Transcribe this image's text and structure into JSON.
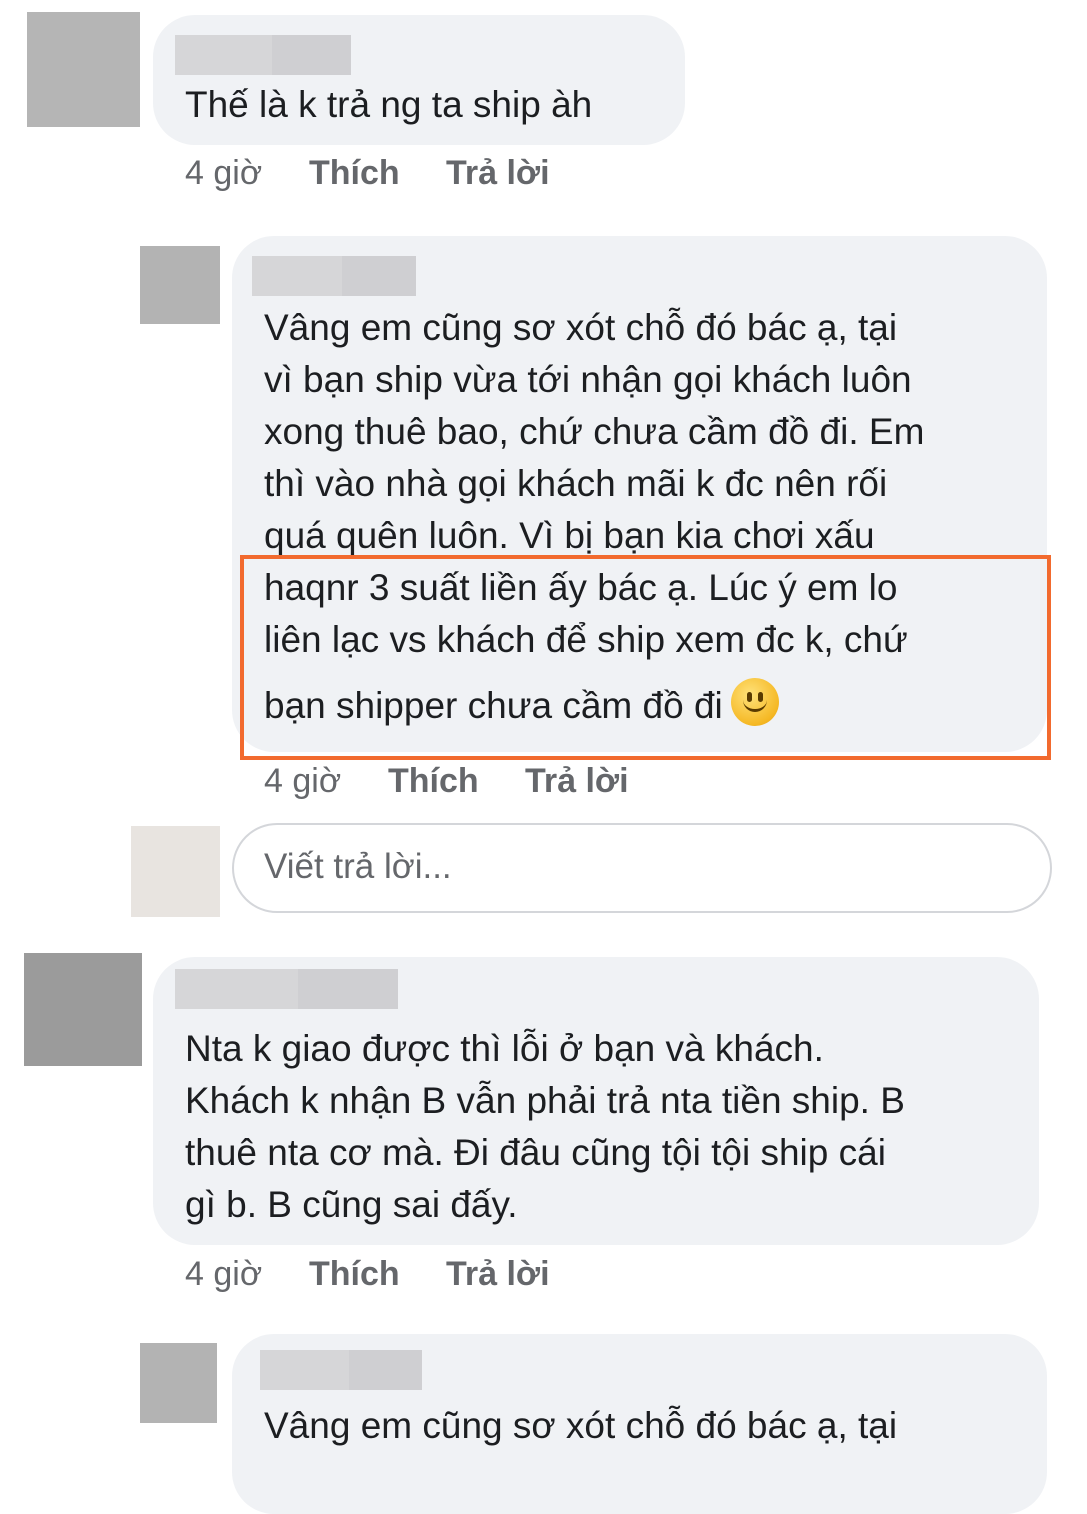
{
  "comments": [
    {
      "text_lines": [
        "Thế là k trả ng ta ship àh"
      ],
      "time": "4 giờ",
      "like": "Thích",
      "reply": "Trả lời"
    },
    {
      "text_lines": [
        "Vâng em cũng sơ xót chỗ đó bác ạ, tại",
        "vì bạn ship vừa tới nhận gọi khách luôn",
        "xong thuê bao, chứ chưa cầm đồ đi. Em",
        "thì vào nhà gọi khách mãi k đc nên rối",
        "quá quên luôn. Vì bị bạn kia chơi xấu",
        "haqnr 3 suất liền ấy bác ạ. Lúc ý em lo",
        "liên lạc vs khách để ship xem đc k, chứ",
        "bạn shipper chưa cầm đồ đi"
      ],
      "emoji": "smiling-face",
      "time": "4 giờ",
      "like": "Thích",
      "reply": "Trả lời"
    },
    {
      "text_lines": [
        "Nta k giao được thì lỗi ở bạn và khách.",
        "Khách k nhận B vẫn phải trả nta tiền ship. B",
        "thuê nta cơ mà. Đi đâu cũng tội tội ship cái",
        "gì b. B cũng sai đấy."
      ],
      "time": "4 giờ",
      "like": "Thích",
      "reply": "Trả lời"
    },
    {
      "text_lines": [
        "Vâng em cũng sơ xót chỗ đó bác ạ, tại"
      ]
    }
  ],
  "reply_box": {
    "placeholder": "Viết trả lời..."
  },
  "colors": {
    "highlight": "#f26a2e",
    "bubble": "#f0f2f5",
    "meta": "#65676b"
  }
}
